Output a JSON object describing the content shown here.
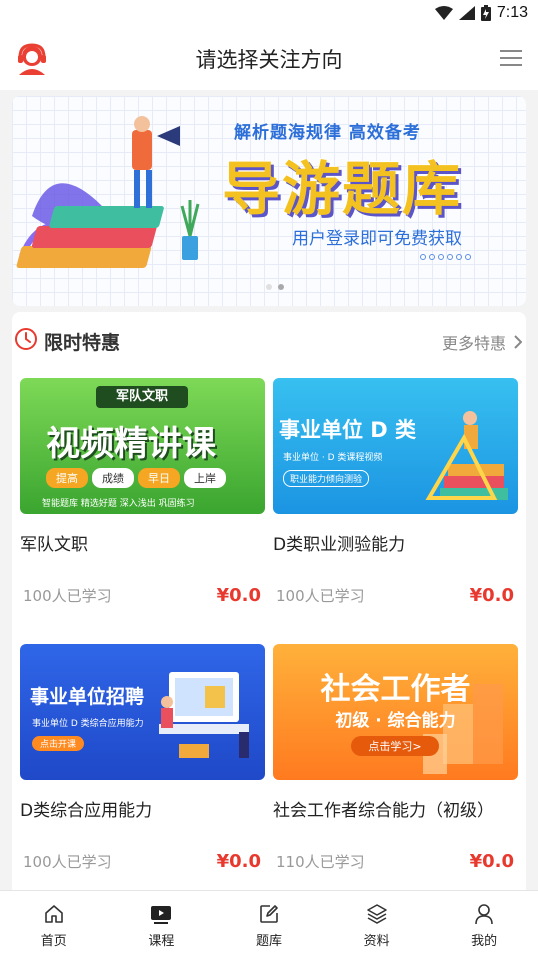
{
  "status_bar": {
    "time": "7:13"
  },
  "header": {
    "title": "请选择关注方向"
  },
  "banner": {
    "tagline": "解析题海规律 高效备考",
    "headline": "导游题库",
    "subtitle": "用户登录即可免费获取",
    "slide_count": 2,
    "active_slide": 0
  },
  "section": {
    "title": "限时特惠",
    "more": "更多特惠"
  },
  "courses": [
    {
      "name": "军队文职",
      "learners": "100人已学习",
      "price": "¥0.0",
      "thumb": {
        "badge": "军队文职",
        "title": "视频精讲课",
        "pills": [
          "提高",
          "成绩",
          "早日",
          "上岸"
        ],
        "foot": "智能题库 精选好题 深入浅出 巩固练习"
      }
    },
    {
      "name": "D类职业测验能力",
      "learners": "100人已学习",
      "price": "¥0.0",
      "thumb": {
        "title": "事业单位 D 类",
        "line1": "事业单位 · D 类课程视频",
        "line2": "职业能力倾向测验"
      }
    },
    {
      "name": "D类综合应用能力",
      "learners": "100人已学习",
      "price": "¥0.0",
      "thumb": {
        "title": "事业单位招聘",
        "line1": "事业单位 D 类综合应用能力",
        "btn": "点击开课"
      }
    },
    {
      "name": "社会工作者综合能力（初级）",
      "learners": "110人已学习",
      "price": "¥0.0",
      "thumb": {
        "title": "社会工作者",
        "line1": "初级 · 综合能力",
        "btn": "点击学习>"
      }
    }
  ],
  "tabs": [
    {
      "label": "首页",
      "icon": "home-icon"
    },
    {
      "label": "课程",
      "icon": "video-icon"
    },
    {
      "label": "题库",
      "icon": "edit-icon"
    },
    {
      "label": "资料",
      "icon": "layers-icon"
    },
    {
      "label": "我的",
      "icon": "user-icon"
    }
  ],
  "colors": {
    "accent": "#e8392f",
    "link": "#2c6fd8",
    "banner_headline": "#f4c220"
  }
}
